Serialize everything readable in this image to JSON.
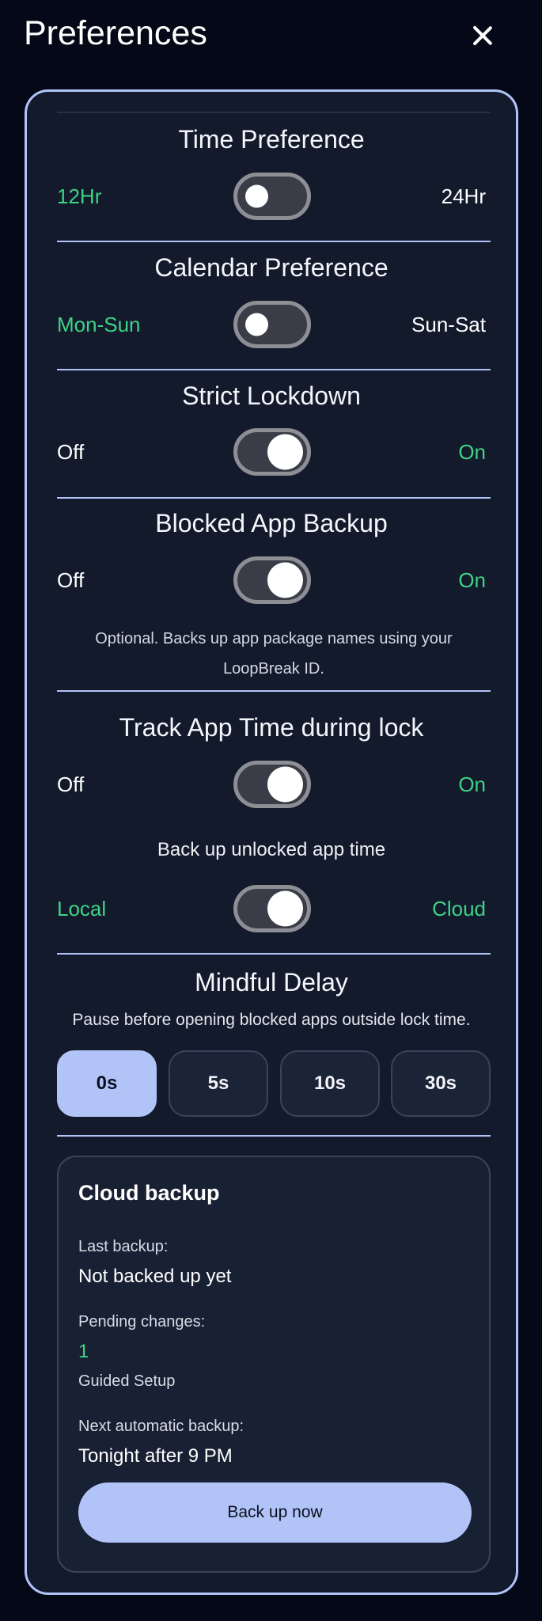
{
  "header": {
    "title": "Preferences"
  },
  "time_preference": {
    "title": "Time Preference",
    "left": "12Hr",
    "right": "24Hr",
    "state": "off"
  },
  "calendar_preference": {
    "title": "Calendar Preference",
    "left": "Mon-Sun",
    "right": "Sun-Sat",
    "state": "off"
  },
  "strict_lockdown": {
    "title": "Strict Lockdown",
    "left": "Off",
    "right": "On",
    "state": "on"
  },
  "blocked_app_backup": {
    "title": "Blocked App Backup",
    "left": "Off",
    "right": "On",
    "state": "on",
    "note_line1": "Optional. Backs up app package names using your",
    "note_line2": "LoopBreak ID."
  },
  "track_app_time": {
    "title": "Track App Time during lock",
    "left": "Off",
    "right": "On",
    "state": "on",
    "sub_title": "Back up unlocked app time",
    "sub_left": "Local",
    "sub_right": "Cloud",
    "sub_state": "on"
  },
  "mindful_delay": {
    "title": "Mindful Delay",
    "description": "Pause before opening blocked apps outside lock time.",
    "options": [
      "0s",
      "5s",
      "10s",
      "30s"
    ],
    "selected": "0s"
  },
  "cloud_backup": {
    "title": "Cloud backup",
    "last_backup_label": "Last backup:",
    "last_backup_value": "Not backed up yet",
    "pending_label": "Pending changes:",
    "pending_count": "1",
    "pending_item": "Guided Setup",
    "next_label": "Next automatic backup:",
    "next_value": "Tonight after 9 PM",
    "button_label": "Back up now"
  },
  "colors": {
    "background": "#050917",
    "panel": "#121a2c",
    "accent": "#b2c3f7",
    "active_option": "#3ed486"
  }
}
